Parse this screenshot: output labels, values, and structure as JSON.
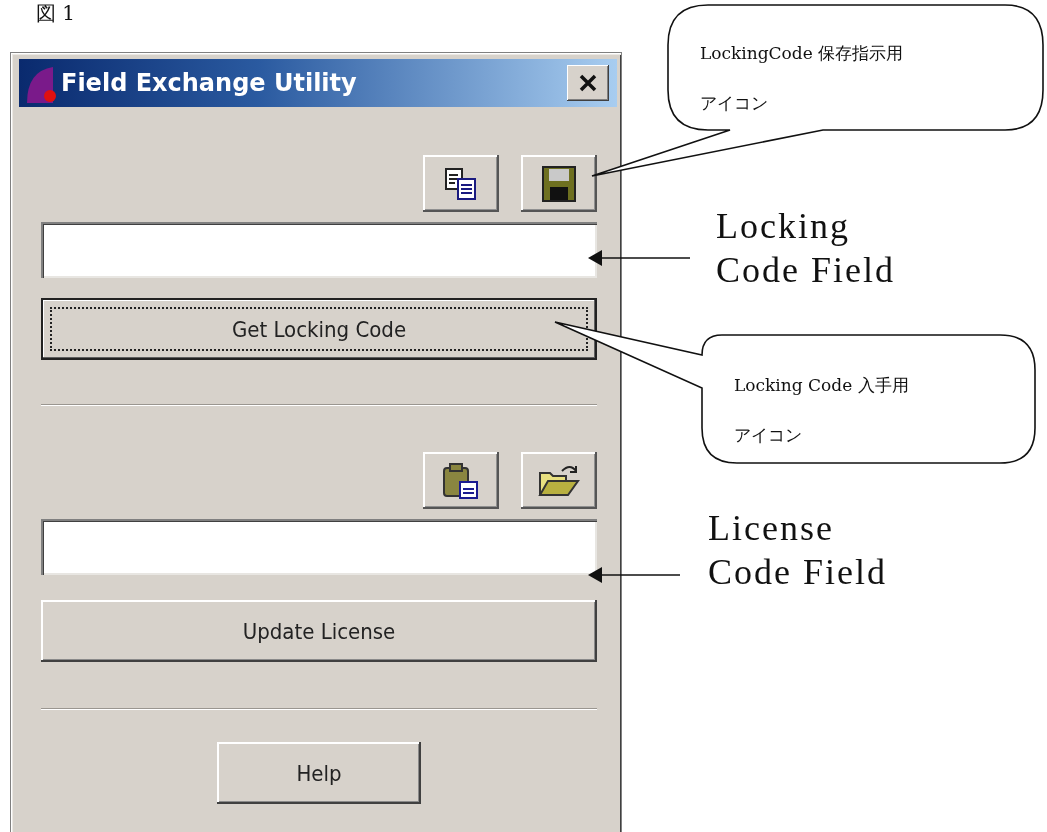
{
  "figure_label": "図 1",
  "window": {
    "title": "Field Exchange Utility"
  },
  "sections": [
    {
      "tools": [
        {
          "kind": "copy"
        },
        {
          "kind": "save"
        }
      ],
      "button": {
        "label": "Get Locking Code",
        "focused": true
      }
    },
    {
      "tools": [
        {
          "kind": "paste"
        },
        {
          "kind": "open"
        }
      ],
      "button": {
        "label": "Update License",
        "focused": false
      }
    }
  ],
  "help_button": {
    "label": "Help",
    "focused": false
  },
  "callouts": [
    {
      "lines": [
        "LockingCode 保存指示用",
        "アイコン"
      ]
    },
    {
      "lines": [
        "Locking Code 入手用",
        "アイコン"
      ]
    }
  ],
  "field_labels": [
    {
      "text": "Locking\nCode Field"
    },
    {
      "text": "License\nCode Field"
    }
  ]
}
